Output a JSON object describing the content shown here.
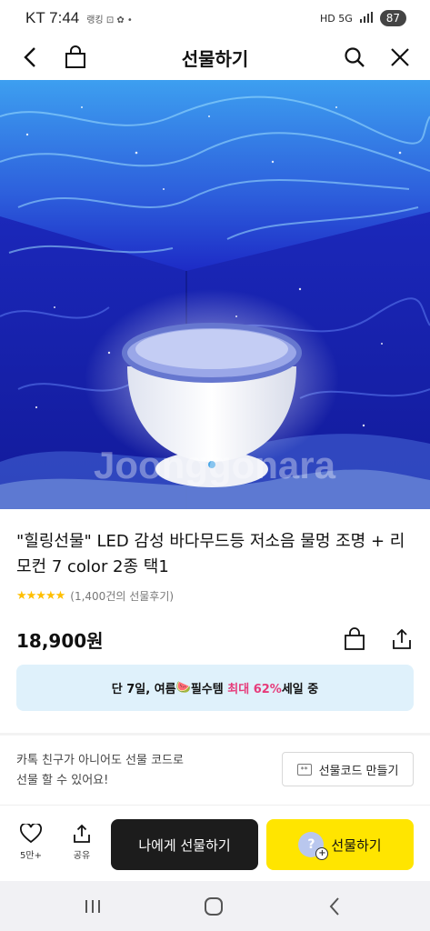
{
  "status_bar": {
    "carrier_time": "KT 7:44",
    "small_icons": "랭킹 ⊡ ✿ •",
    "network": "HD 5G",
    "battery": "87"
  },
  "header": {
    "title": "선물하기",
    "back_icon": "chevron-left-icon",
    "bag_icon": "shopping-bag-icon",
    "search_icon": "search-icon",
    "close_icon": "close-icon"
  },
  "product": {
    "watermark": "Joonggonara",
    "title": "\"힐링선물\" LED 감성 바다무드등 저소음 물멍 조명 + 리모컨 7 color 2종 택1",
    "stars": "★★★★★",
    "review_text": "(1,400건의 선물후기)",
    "price": "18,900원"
  },
  "promo": {
    "prefix": "단 7일, 여름",
    "emoji": "🍉",
    "middle": "필수템 ",
    "highlight": "최대 62%",
    "suffix": "세일 중"
  },
  "gift_note": {
    "line1": "카톡 친구가 아니어도 선물 코드로",
    "line2": "선물 할 수 있어요!",
    "code_icon": "**",
    "code_button": "선물코드 만들기"
  },
  "actions": {
    "like_count": "5만+",
    "share_label": "공유",
    "gift_me": "나에게 선물하기",
    "gift": "선물하기",
    "gift_avatar": "?",
    "gift_plus": "+"
  },
  "colors": {
    "accent_yellow": "#ffe500",
    "promo_bg": "#dff1fb",
    "promo_accent": "#e63b7a",
    "star": "#ffbf00"
  }
}
